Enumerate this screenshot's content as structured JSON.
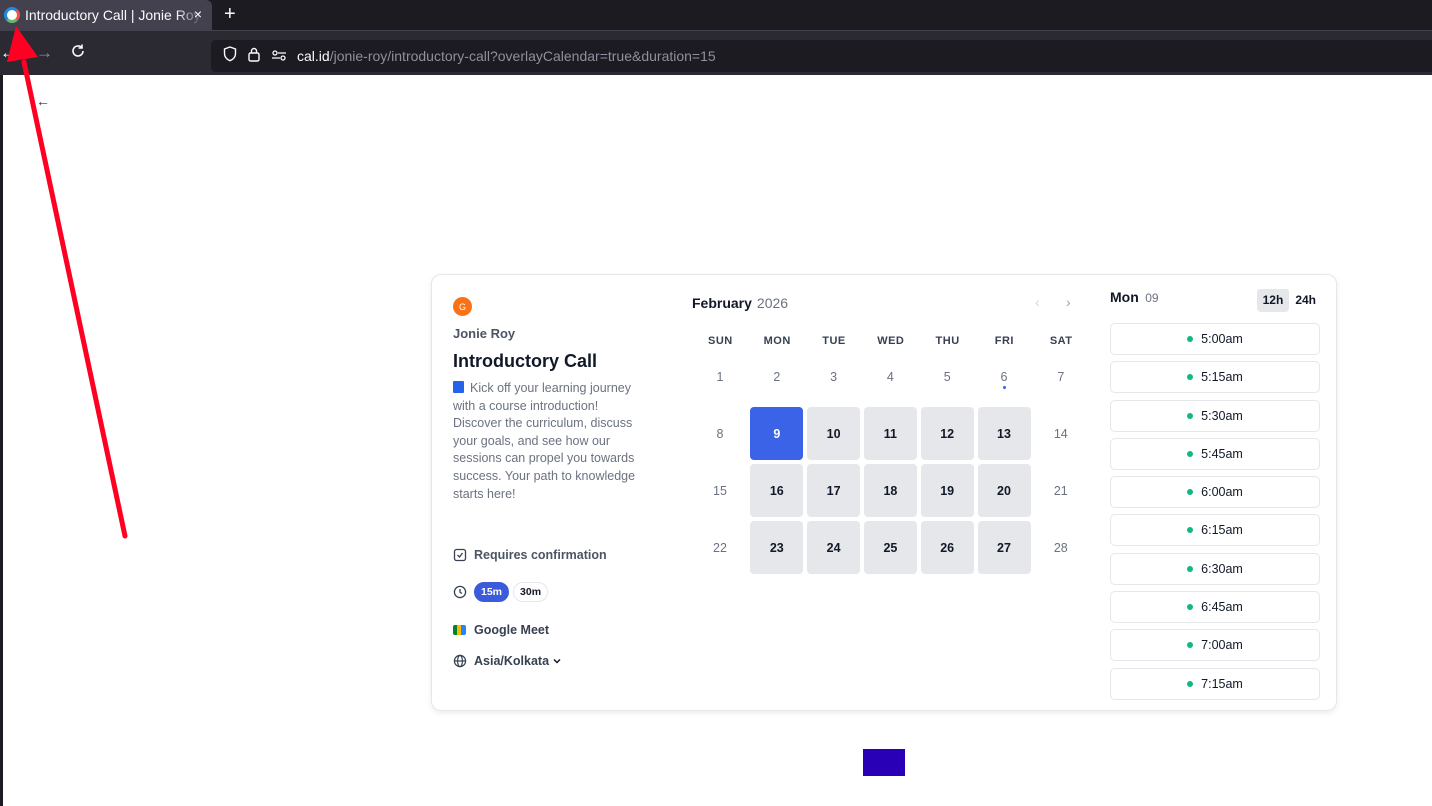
{
  "browser": {
    "tab_title": "Introductory Call | Jonie Roy | Cal.id",
    "tab_close": "×",
    "new_tab": "+",
    "url_host": "cal.id",
    "url_path": "/jonie-roy/introductory-call?overlayCalendar=true&duration=15",
    "icons": [
      "back-arrow-icon",
      "forward-arrow-icon",
      "reload-icon",
      "shield-icon",
      "lock-icon",
      "permissions-icon"
    ]
  },
  "page": {
    "back_icon": "←"
  },
  "event": {
    "avatar_initial": "G",
    "host_name": "Jonie Roy",
    "title": "Introductory Call",
    "description": "Kick off your learning journey with a course introduction! Discover the curriculum, discuss your goals, and see how our sessions can propel you towards success. Your path to knowledge starts here!",
    "requires_confirmation": "Requires confirmation",
    "durations": [
      "15m",
      "30m"
    ],
    "selected_duration": "15m",
    "location": "Google Meet",
    "timezone": "Asia/Kolkata"
  },
  "calendar": {
    "month": "February",
    "year": "2026",
    "weekdays": [
      "SUN",
      "MON",
      "TUE",
      "WED",
      "THU",
      "FRI",
      "SAT"
    ],
    "days": [
      "1",
      "2",
      "3",
      "4",
      "5",
      "6",
      "7",
      "8",
      "9",
      "10",
      "11",
      "12",
      "13",
      "14",
      "15",
      "16",
      "17",
      "18",
      "19",
      "20",
      "21",
      "22",
      "23",
      "24",
      "25",
      "26",
      "27",
      "28"
    ],
    "available_days": [
      "9",
      "10",
      "11",
      "12",
      "13",
      "16",
      "17",
      "18",
      "19",
      "20",
      "23",
      "24",
      "25",
      "26",
      "27"
    ],
    "selected_day": "9",
    "today_marker_day": "6"
  },
  "slots": {
    "day_label": "Mon",
    "date_label": "09",
    "format_12h": "12h",
    "format_24h": "24h",
    "times": [
      "5:00am",
      "5:15am",
      "5:30am",
      "5:45am",
      "6:00am",
      "6:15am",
      "6:30am",
      "6:45am",
      "7:00am",
      "7:15am"
    ]
  },
  "colors": {
    "selected_day": "#3b63e8",
    "available_dot": "#10b981",
    "annotation_arrow": "#ff0022",
    "purple_block": "#2a00b7"
  }
}
